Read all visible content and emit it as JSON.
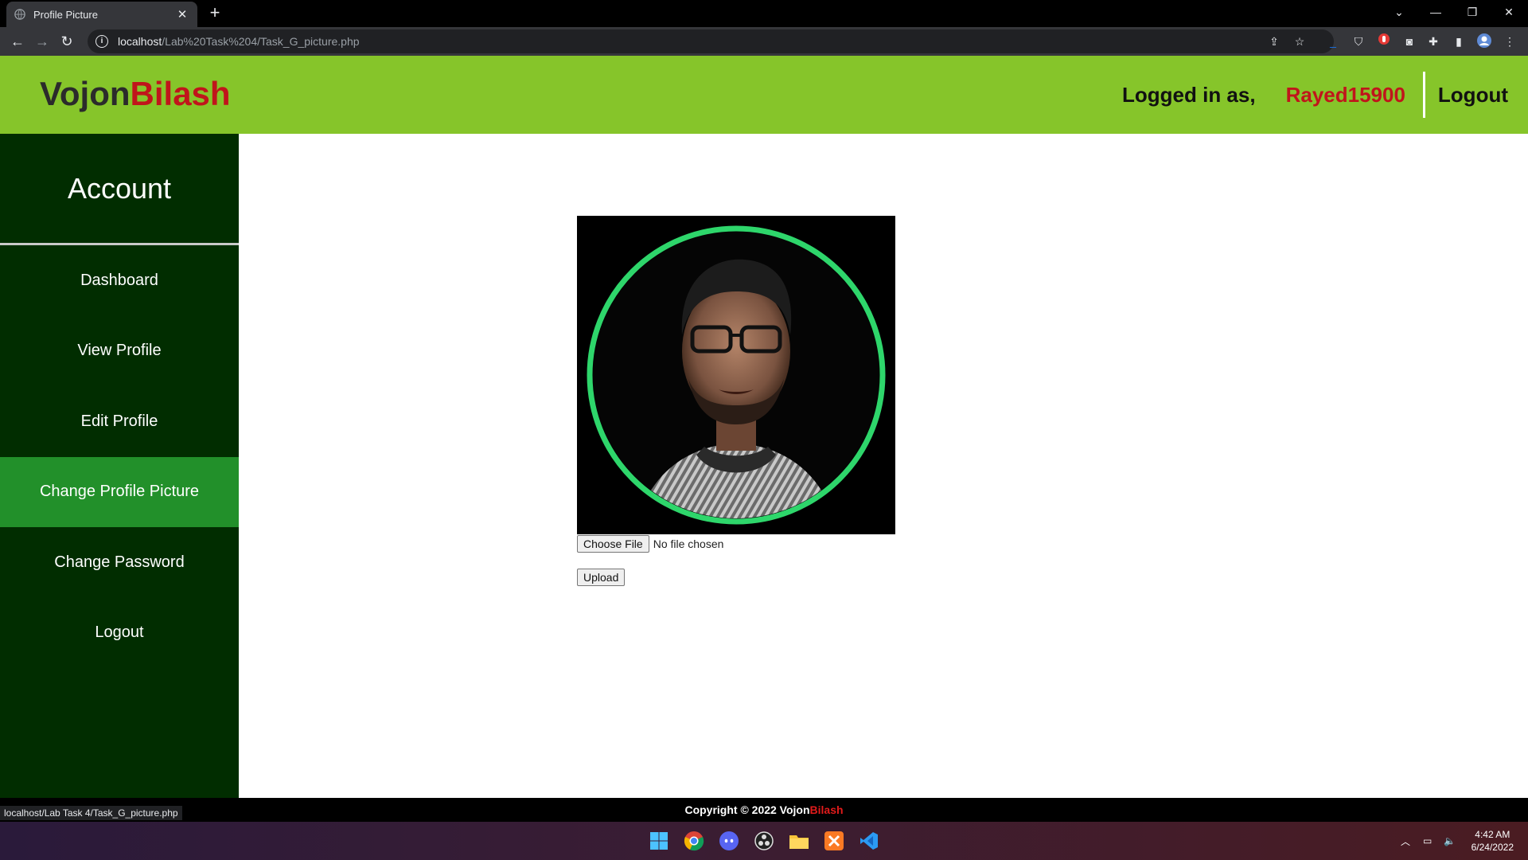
{
  "browser": {
    "tab_title": "Profile Picture",
    "url_host": "localhost",
    "url_path": "/Lab%20Task%204/Task_G_picture.php",
    "status_url": "localhost/Lab Task 4/Task_G_picture.php"
  },
  "header": {
    "brand_part1": "Vojon",
    "brand_part2": "Bilash",
    "logged_in_label": "Logged in as,",
    "username": "Rayed15900",
    "logout_label": "Logout"
  },
  "sidebar": {
    "title": "Account",
    "items": [
      {
        "label": "Dashboard"
      },
      {
        "label": "View Profile"
      },
      {
        "label": "Edit Profile"
      },
      {
        "label": "Change Profile Picture",
        "active": true
      },
      {
        "label": "Change Password"
      },
      {
        "label": "Logout"
      }
    ]
  },
  "main": {
    "choose_file_label": "Choose File",
    "file_status": "No file chosen",
    "upload_label": "Upload"
  },
  "footer": {
    "copyright_prefix": "Copyright © 2022 Vojon",
    "copyright_brand": "Bilash"
  },
  "taskbar": {
    "time": "4:42 AM",
    "date": "6/24/2022"
  },
  "colors": {
    "header_green": "#86c52a",
    "sidebar_dark": "#012d00",
    "active_item": "#22902a",
    "brand_red": "#c0151b",
    "ring_green": "#2ed66b"
  }
}
